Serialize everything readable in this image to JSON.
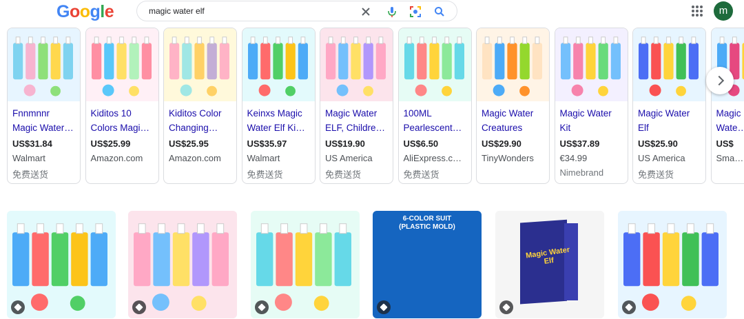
{
  "header": {
    "logo_letters": [
      {
        "ch": "G",
        "color": "#4285F4"
      },
      {
        "ch": "o",
        "color": "#EA4335"
      },
      {
        "ch": "o",
        "color": "#FBBC05"
      },
      {
        "ch": "g",
        "color": "#4285F4"
      },
      {
        "ch": "l",
        "color": "#34A853"
      },
      {
        "ch": "e",
        "color": "#EA4335"
      }
    ],
    "search_query": "magic water elf",
    "icons": [
      "clear-icon",
      "microphone-icon",
      "camera-lens-icon",
      "search-icon"
    ],
    "apps_icon": "apps-grid-icon",
    "avatar_letter": "m",
    "avatar_color": "#1e6b3c"
  },
  "products": [
    {
      "title1": "Fnnmnnr",
      "title2": "Magic Water…",
      "price": "US$31.84",
      "m1": "Walmart",
      "m2": "免费送货"
    },
    {
      "title1": "Kiditos 10",
      "title2": "Colors Magi…",
      "price": "US$25.99",
      "m1": "Amazon.com",
      "m2": ""
    },
    {
      "title1": "Kiditos Color",
      "title2": "Changing…",
      "price": "US$25.95",
      "m1": "Amazon.com",
      "m2": ""
    },
    {
      "title1": "Keinxs Magic",
      "title2": "Water Elf Ki…",
      "price": "US$35.97",
      "m1": "Walmart",
      "m2": "免费送货"
    },
    {
      "title1": "Magic Water",
      "title2": "ELF, Childre…",
      "price": "US$19.90",
      "m1": "US America",
      "m2": "免费送货"
    },
    {
      "title1": "100ML",
      "title2": "Pearlescent…",
      "price": "US$6.50",
      "m1": "AliExpress.c…",
      "m2": "免费送货"
    },
    {
      "title1": "Magic Water",
      "title2": "Creatures",
      "price": "US$29.90",
      "m1": "TinyWonders",
      "m2": ""
    },
    {
      "title1": "Magic Water",
      "title2": "Kit",
      "price": "US$37.89",
      "m1": "€34.99",
      "m2": "Nimebrand"
    },
    {
      "title1": "Magic Water",
      "title2": "Elf",
      "price": "US$25.90",
      "m1": "US America",
      "m2": "免费送货"
    },
    {
      "title1": "Magic",
      "title2": "Wate…",
      "price": "US$",
      "m1": "Sma…",
      "m2": ""
    }
  ],
  "image_tiles": [
    {
      "caption": ""
    },
    {
      "caption": ""
    },
    {
      "caption": ""
    },
    {
      "caption": "6-COLOR SUIT\n(PLASTIC MOLD)"
    },
    {
      "caption": "Magic Water Elf"
    },
    {
      "caption": ""
    }
  ],
  "colors": {
    "link": "#1a0dab",
    "accent": "#4285F4"
  }
}
